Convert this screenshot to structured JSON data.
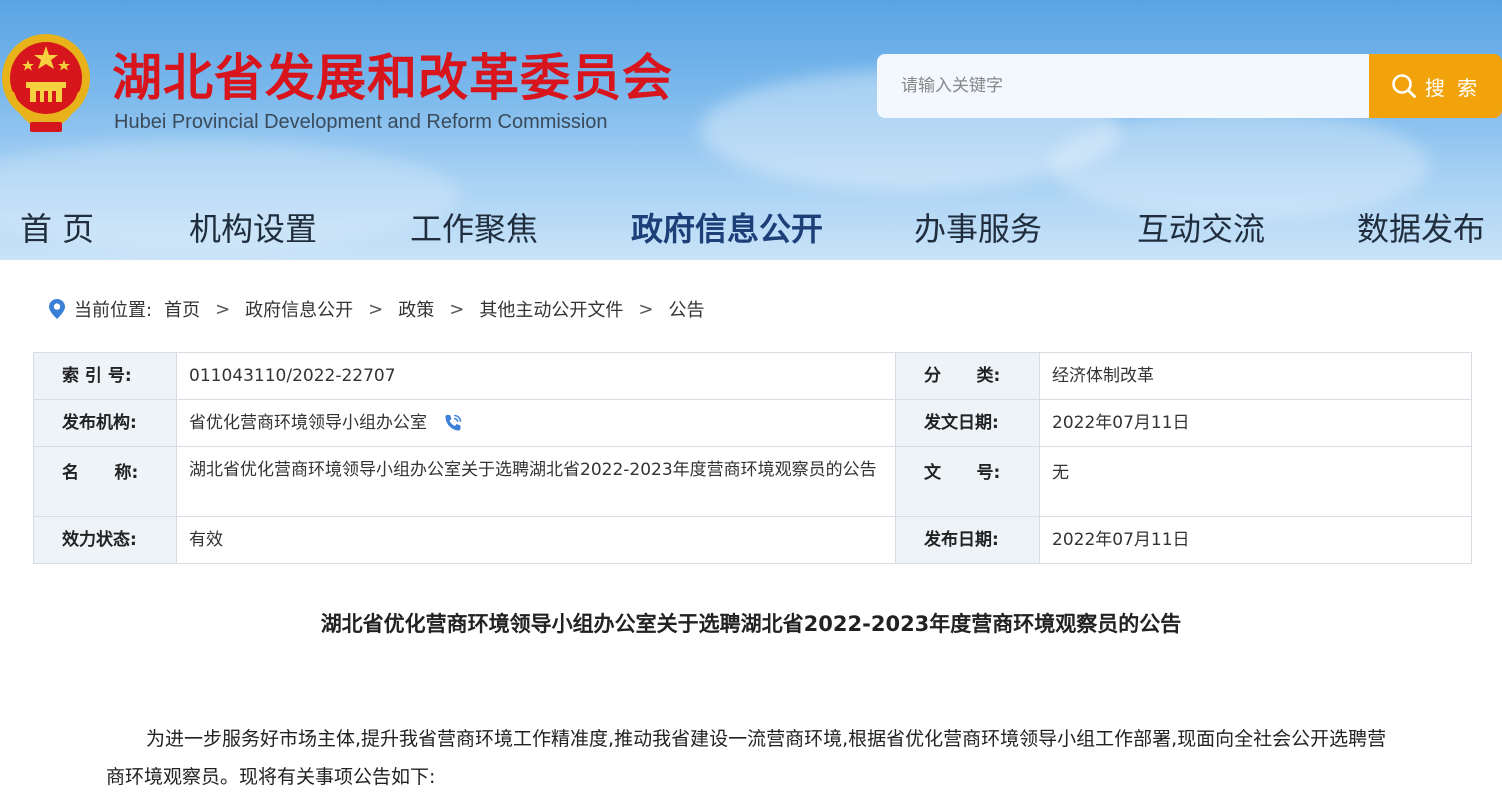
{
  "header": {
    "title": "湖北省发展和改革委员会",
    "subtitle": "Hubei Provincial Development and Reform Commission",
    "search_placeholder": "请输入关键字",
    "search_button": "搜 索",
    "emblem_icon": "national-emblem-icon"
  },
  "nav": {
    "items": [
      "首 页",
      "机构设置",
      "工作聚焦",
      "政府信息公开",
      "办事服务",
      "互动交流",
      "数据发布"
    ],
    "active": "政府信息公开"
  },
  "breadcrumb": {
    "prefix": "当前位置:",
    "items": [
      "首页",
      "政府信息公开",
      "政策",
      "其他主动公开文件",
      "公告"
    ],
    "separator": ">"
  },
  "info": {
    "index_label": "索 引 号:",
    "index_value": "011043110/2022-22707",
    "category_label": "分      类:",
    "category_value": "经济体制改革",
    "publisher_label": "发布机构:",
    "publisher_value": "省优化营商环境领导小组办公室",
    "doc_date_label": "发文日期:",
    "doc_date_value": "2022年07月11日",
    "name_label": "名      称:",
    "name_value": "湖北省优化营商环境领导小组办公室关于选聘湖北省2022-2023年度营商环境观察员的公告",
    "doc_no_label": "文      号:",
    "doc_no_value": "无",
    "status_label": "效力状态:",
    "status_value": "有效",
    "pub_date_label": "发布日期:",
    "pub_date_value": "2022年07月11日"
  },
  "article": {
    "title": "湖北省优化营商环境领导小组办公室关于选聘湖北省2022-2023年度营商环境观察员的公告",
    "paragraph": "为进一步服务好市场主体,提升我省营商环境工作精准度,推动我省建设一流营商环境,根据省优化营商环境领导小组工作部署,现面向全社会公开选聘营商环境观察员。现将有关事项公告如下:"
  },
  "colors": {
    "title_red": "#d8141c",
    "search_orange": "#f2a20a",
    "nav_active": "#1c3f78",
    "label_bg": "#eef3f8"
  }
}
